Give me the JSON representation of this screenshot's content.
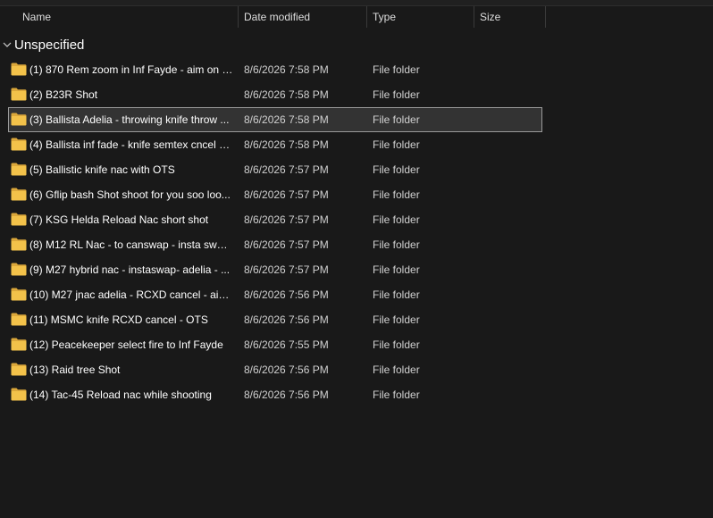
{
  "columns": {
    "name": "Name",
    "date_modified": "Date modified",
    "type": "Type",
    "size": "Size"
  },
  "group": {
    "label": "Unspecified",
    "icon": "chevron-down-icon"
  },
  "colors": {
    "background": "#191919",
    "folder": "#f3c24a",
    "folder_dark": "#dba73a",
    "selection": "#333333"
  },
  "items": [
    {
      "name": "(1) 870 Rem zoom in Inf Fayde - aim on n...",
      "date": "8/6/2026 7:58 PM",
      "type": "File folder"
    },
    {
      "name": "(2) B23R Shot",
      "date": "8/6/2026 7:58 PM",
      "type": "File folder"
    },
    {
      "name": "(3) Ballista Adelia - throwing knife throw ...",
      "date": "8/6/2026 7:58 PM",
      "type": "File folder",
      "selected": true
    },
    {
      "name": "(4) Ballista inf fade - knife semtex cncel - ...",
      "date": "8/6/2026 7:58 PM",
      "type": "File folder"
    },
    {
      "name": "(5) Ballistic knife nac with OTS",
      "date": "8/6/2026 7:57 PM",
      "type": "File folder"
    },
    {
      "name": "(6) Gflip bash Shot shoot for you soo loo...",
      "date": "8/6/2026 7:57 PM",
      "type": "File folder"
    },
    {
      "name": "(7) KSG Helda Reload Nac short shot",
      "date": "8/6/2026 7:57 PM",
      "type": "File folder"
    },
    {
      "name": "(8) M12 RL Nac - to canswap - insta swap...",
      "date": "8/6/2026 7:57 PM",
      "type": "File folder"
    },
    {
      "name": "(9) M27 hybrid nac - instaswap- adelia - ...",
      "date": "8/6/2026 7:57 PM",
      "type": "File folder"
    },
    {
      "name": "(10) M27 jnac adelia - RCXD cancel - aim ...",
      "date": "8/6/2026 7:56 PM",
      "type": "File folder"
    },
    {
      "name": "(11) MSMC knife RCXD cancel - OTS",
      "date": "8/6/2026 7:56 PM",
      "type": "File folder"
    },
    {
      "name": "(12) Peacekeeper select fire to Inf Fayde",
      "date": "8/6/2026 7:55 PM",
      "type": "File folder"
    },
    {
      "name": "(13) Raid tree Shot",
      "date": "8/6/2026 7:56 PM",
      "type": "File folder"
    },
    {
      "name": "(14) Tac-45 Reload nac while shooting",
      "date": "8/6/2026 7:56 PM",
      "type": "File folder"
    }
  ]
}
